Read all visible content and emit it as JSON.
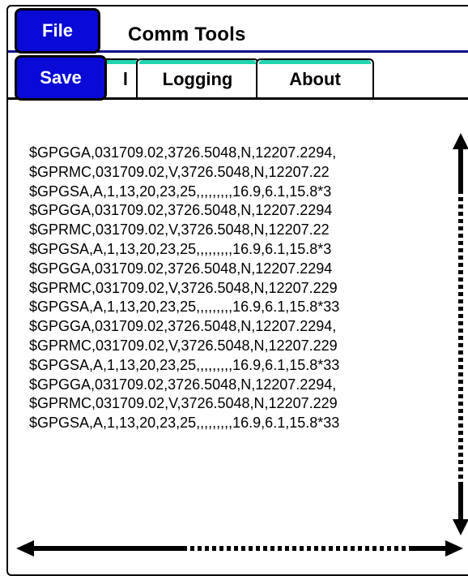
{
  "app": {
    "title": "Comm  Tools",
    "file_label": "File",
    "save_label": "Save"
  },
  "tabs": [
    {
      "label": "l",
      "selected": true
    },
    {
      "label": "Logging",
      "selected": false
    },
    {
      "label": "About",
      "selected": false
    }
  ],
  "log_lines": [
    "$GPGGA,031709.02,3726.5048,N,12207.2294,",
    "$GPRMC,031709.02,V,3726.5048,N,12207.22",
    "$GPGSA,A,1,13,20,23,25,,,,,,,,,16.9,6.1,15.8*3",
    "$GPGGA,031709.02,3726.5048,N,12207.2294",
    "$GPRMC,031709.02,V,3726.5048,N,12207.22",
    "$GPGSA,A,1,13,20,23,25,,,,,,,,,16.9,6.1,15.8*3",
    "$GPGGA,031709.02,3726.5048,N,12207.2294",
    "$GPRMC,031709.02,V,3726.5048,N,12207.229",
    "$GPGSA,A,1,13,20,23,25,,,,,,,,,16.9,6.1,15.8*33",
    "$GPGGA,031709.02,3726.5048,N,12207.2294,",
    "$GPRMC,031709.02,V,3726.5048,N,12207.229",
    "$GPGSA,A,1,13,20,23,25,,,,,,,,,16.9,6.1,15.8*33",
    "$GPGGA,031709.02,3726.5048,N,12207.2294,",
    "$GPRMC,031709.02,V,3726.5048,N,12207.229",
    "$GPGSA,A,1,13,20,23,25,,,,,,,,,16.9,6.1,15.8*33"
  ],
  "colors": {
    "button_blue": "#0a0ad6",
    "title_underline": "#0a0a8c",
    "tab_accent": "#22d3b0"
  },
  "icons": {
    "vertical_scroll": "double-arrow-vertical-icon",
    "horizontal_scroll": "double-arrow-horizontal-icon"
  }
}
